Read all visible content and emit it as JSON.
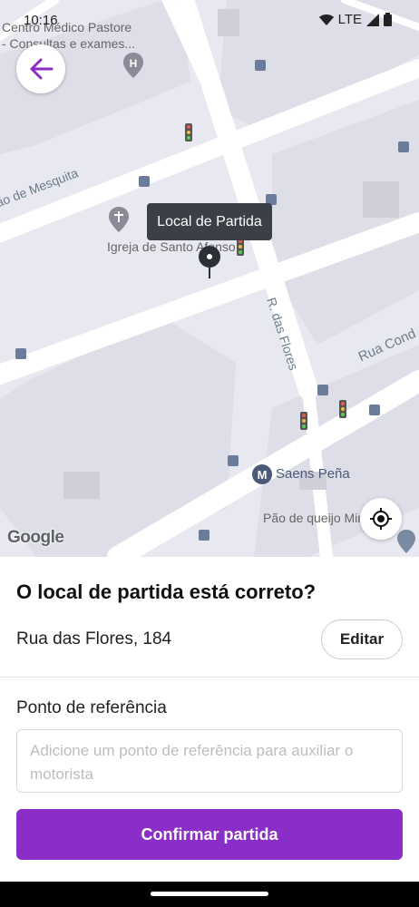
{
  "status_bar": {
    "time": "10:16",
    "network": "LTE"
  },
  "map": {
    "tooltip": "Local de Partida",
    "labels": {
      "clinic_line1": "Centro Médico Pastore",
      "clinic_line2": "- Consultas e exames...",
      "church": "Igreja de Santo Afonso",
      "street_mesquita": "ão de Mesquita",
      "street_flores": "R. das Flores",
      "street_rua_cond": "Rua Cond",
      "metro": "Saens Peña",
      "bakery": "Pão de queijo Mineiraria"
    },
    "attribution": "Google"
  },
  "sheet": {
    "question": "O local de partida está correto?",
    "address": "Rua das Flores, 184",
    "edit_label": "Editar",
    "ref_label": "Ponto de referência",
    "ref_placeholder": "Adicione um ponto de referência para auxiliar o motorista",
    "confirm_label": "Confirmar partida"
  },
  "colors": {
    "accent": "#8a2ec7",
    "tooltip_bg": "#3b3f47"
  }
}
